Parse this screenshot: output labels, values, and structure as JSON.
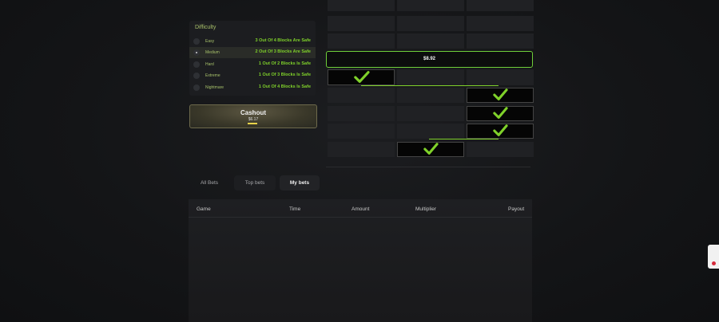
{
  "difficulty": {
    "title": "Difficulty",
    "levels": [
      {
        "name": "Easy",
        "desc": "3 Out Of 4 Blocks Are Safe"
      },
      {
        "name": "Medium",
        "desc": "2 Out Of 3 Blocks Are Safe"
      },
      {
        "name": "Hard",
        "desc": "1 Out Of 2 Blocks Is Safe"
      },
      {
        "name": "Extreme",
        "desc": "1 Out Of 3 Blocks Is Safe"
      },
      {
        "name": "Nightmare",
        "desc": "1 Out Of 4 Blocks Is Safe"
      }
    ],
    "selected": "Medium"
  },
  "cashout": {
    "label": "Cashout",
    "amount": "$6.17"
  },
  "board": {
    "current_multiplier_payout": "$8.92"
  },
  "bets_tabs": [
    {
      "label": "All Bets"
    },
    {
      "label": "Top bets"
    },
    {
      "label": "My bets"
    }
  ],
  "active_tab": "My bets",
  "table": {
    "headers": [
      "Game",
      "Time",
      "Amount",
      "Multiplier",
      "Payout"
    ]
  },
  "colors": {
    "accent_green": "#7fd12a",
    "gold": "#e8d34a"
  },
  "icons": {
    "check": "check-icon"
  }
}
